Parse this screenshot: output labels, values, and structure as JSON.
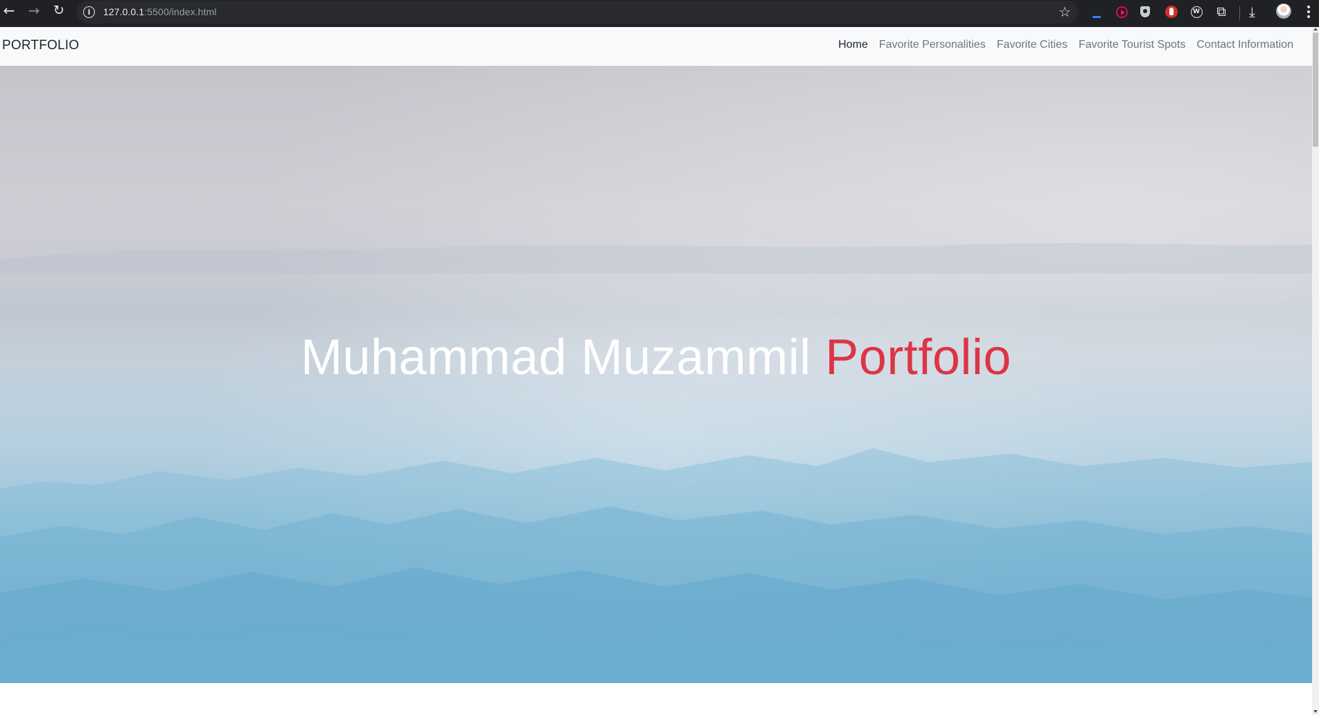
{
  "browser": {
    "url_host": "127.0.0.1",
    "url_path": ":5500/index.html",
    "icons": {
      "back": "arrow-left-icon",
      "forward": "arrow-right-icon",
      "reload": "reload-icon",
      "site_info": "info-icon",
      "bookmark": "star-icon",
      "downloads": "download-icon",
      "extensions": "puzzle-icon",
      "menu": "kebab-menu-icon"
    }
  },
  "navbar": {
    "brand": "PORTFOLIO",
    "links": [
      {
        "label": "Home",
        "active": true
      },
      {
        "label": "Favorite Personalities",
        "active": false
      },
      {
        "label": "Favorite Cities",
        "active": false
      },
      {
        "label": "Favorite Tourist Spots",
        "active": false
      },
      {
        "label": "Contact Information",
        "active": false
      }
    ]
  },
  "hero": {
    "name": "Muhammad Muzammil",
    "accent_word": "Portfolio"
  },
  "colors": {
    "accent": "#dc3545",
    "navbar_bg": "#f8f9fa",
    "browser_bg": "#202124"
  }
}
